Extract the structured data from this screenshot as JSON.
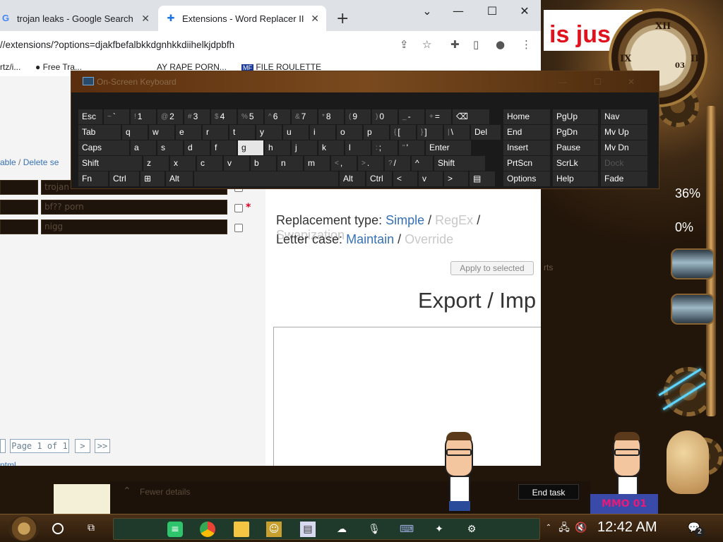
{
  "browser": {
    "tabs": [
      {
        "label": "trojan leaks - Google Search",
        "favicon": "google-icon"
      },
      {
        "label": "Extensions - Word Replacer II",
        "favicon": "puzzle-icon"
      }
    ],
    "url": "//extensions/?options=djakfbefalbkkdgnhkkdiihelkjdpbfh",
    "bookmarks": [
      "rtz/i...",
      "Free Tra...",
      "AY RAPE PORN...",
      "FILE ROULETTE"
    ]
  },
  "extension": {
    "left": {
      "links": {
        "table": "able",
        "sep": " / ",
        "delete": "Delete se"
      },
      "rows": [
        {
          "text": "trojan",
          "starred": false
        },
        {
          "text": "bf?? porn",
          "starred": true
        },
        {
          "text": "nigg",
          "starred": false
        }
      ],
      "star": "*",
      "pager": {
        "page_label": "Page 1 of 1",
        "next": ">",
        "last": ">>"
      },
      "bottom_link": "ntml"
    },
    "right": {
      "replacement_type_label": "Replacement type:",
      "replacement_options": [
        "Simple",
        "RegEx",
        "Swapization"
      ],
      "letter_case_label": "Letter case:",
      "letter_case_options": [
        "Maintain",
        "Override"
      ],
      "apply_label": "Apply to selected",
      "export_title": "Export / Imp",
      "behind_text": "rts"
    }
  },
  "osk": {
    "title": "On-Screen Keyboard",
    "rows": [
      [
        "Esc",
        "~ `",
        "! 1",
        "@ 2",
        "# 3",
        "$ 4",
        "% 5",
        "^ 6",
        "& 7",
        "* 8",
        "( 9",
        ") 0",
        "_ -",
        "+ =",
        "⌫"
      ],
      [
        "Tab",
        "q",
        "w",
        "e",
        "r",
        "t",
        "y",
        "u",
        "i",
        "o",
        "p",
        "{ [",
        "} ]",
        "| \\",
        "Del"
      ],
      [
        "Caps",
        "a",
        "s",
        "d",
        "f",
        "g",
        "h",
        "j",
        "k",
        "l",
        ": ;",
        "\" '",
        "Enter"
      ],
      [
        "Shift",
        "z",
        "x",
        "c",
        "v",
        "b",
        "n",
        "m",
        "< ,",
        "> .",
        "? /",
        "^",
        "Shift"
      ],
      [
        "Fn",
        "Ctrl",
        "⊞",
        "Alt",
        "",
        "Alt",
        "Ctrl",
        "<",
        "v",
        ">",
        "▤"
      ]
    ],
    "nav": [
      [
        "Home",
        "PgUp",
        "Nav"
      ],
      [
        "End",
        "PgDn",
        "Mv Up"
      ],
      [
        "Insert",
        "Pause",
        "Mv Dn"
      ],
      [
        "PrtScn",
        "ScrLk",
        "Dock"
      ],
      [
        "Options",
        "Help",
        "Fade"
      ]
    ]
  },
  "desktop": {
    "banner": "is jus",
    "clock_label": "03",
    "pct1": "36%",
    "pct2": "0%"
  },
  "taskmgr": {
    "fewer": "Fewer details",
    "end_task": "End task"
  },
  "taskbar": {
    "time": "12:42 AM",
    "notif_count": "2",
    "sticker": "MMO 01"
  },
  "colors": {
    "link": "#3671b6",
    "star": "#dd0022",
    "osk_key": "#2b2b2b"
  }
}
